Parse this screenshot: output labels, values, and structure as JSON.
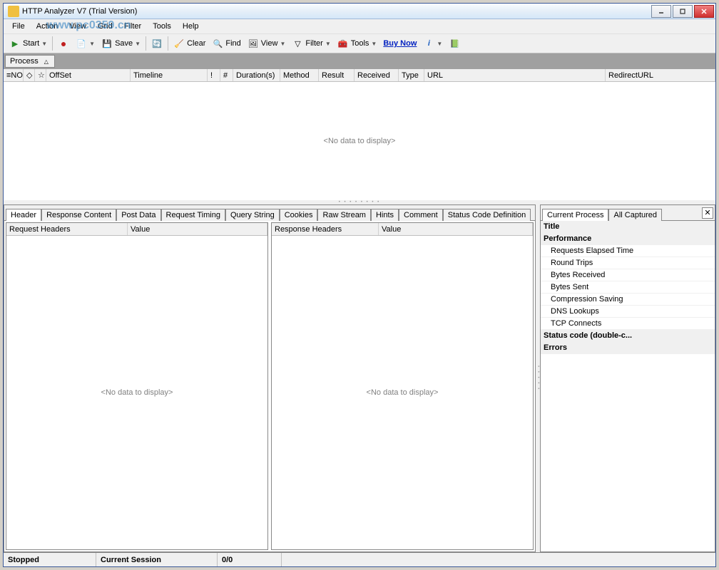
{
  "window": {
    "title": "HTTP Analyzer V7   (Trial Version)"
  },
  "menubar": [
    "File",
    "Action",
    "View",
    "Grid",
    "Filter",
    "Tools",
    "Help"
  ],
  "toolbar": {
    "start": "Start",
    "stop_icon": "●",
    "save": "Save",
    "clear": "Clear",
    "find": "Find",
    "view": "View",
    "filter": "Filter",
    "tools": "Tools",
    "buynow": "Buy Now",
    "info_icon": "i"
  },
  "process_button": "Process",
  "grid_columns": [
    "NO",
    "",
    "",
    "OffSet",
    "Timeline",
    "!",
    "#",
    "Duration(s)",
    "Method",
    "Result",
    "Received",
    "Type",
    "URL",
    "RedirectURL"
  ],
  "grid_empty": "<No data to display>",
  "detail_tabs": [
    "Header",
    "Response Content",
    "Post Data",
    "Request Timing",
    "Query String",
    "Cookies",
    "Raw Stream",
    "Hints",
    "Comment",
    "Status Code Definition"
  ],
  "detail_active_tab": 0,
  "req_headers": {
    "col1": "Request Headers",
    "col2": "Value",
    "empty": "<No data to display>"
  },
  "res_headers": {
    "col1": "Response Headers",
    "col2": "Value",
    "empty": "<No data to display>"
  },
  "right_tabs": [
    "Current Process",
    "All Captured"
  ],
  "right_active_tab": 0,
  "properties": [
    {
      "label": "Title",
      "bold": true
    },
    {
      "label": "Performance",
      "bold": true
    },
    {
      "label": "Requests Elapsed Time",
      "sub": true
    },
    {
      "label": "Round Trips",
      "sub": true
    },
    {
      "label": "Bytes Received",
      "sub": true
    },
    {
      "label": "Bytes Sent",
      "sub": true
    },
    {
      "label": "Compression Saving",
      "sub": true
    },
    {
      "label": "DNS Lookups",
      "sub": true
    },
    {
      "label": "TCP Connects",
      "sub": true
    },
    {
      "label": "Status code (double-c...",
      "bold": true
    },
    {
      "label": "Errors",
      "bold": true
    }
  ],
  "statusbar": {
    "state": "Stopped",
    "session": "Current Session",
    "count": "0/0"
  },
  "watermark": "www.pc0359.cn"
}
